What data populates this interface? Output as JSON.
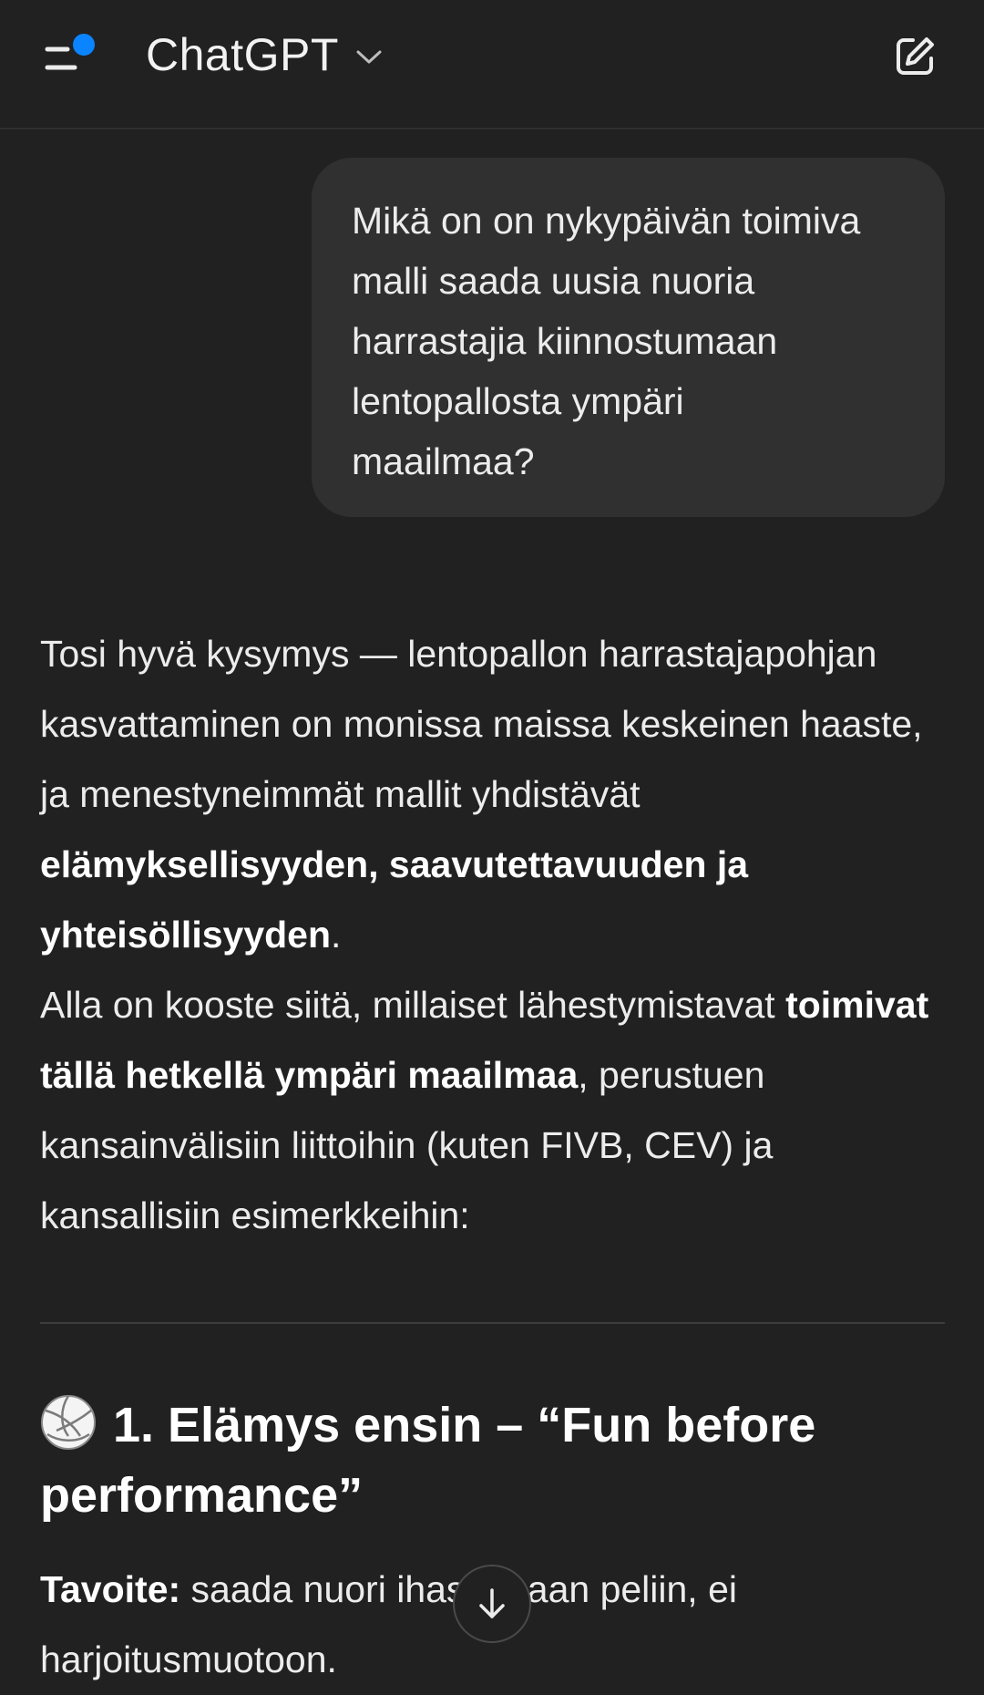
{
  "header": {
    "title": "ChatGPT",
    "menu_icon": "menu-icon",
    "notification_color": "#0A84FF",
    "chevron_icon": "chevron-down-icon",
    "compose_icon": "new-chat-icon"
  },
  "user_message": {
    "text": "Mikä on on nykypäivän toimiva\nmalli saada uusia nuoria\nharrastajia kiinnostumaan\nlentopallosta ympäri\nmaailmaa?"
  },
  "answer": {
    "p1_part1": "Tosi hyvä kysymys — lentopallon harrastajapohjan kasvattaminen on monissa maissa keskeinen haaste, ja menestyneimmät mallit yhdistävät ",
    "p1_bold": "elämyksellisyyden, saavutettavuuden ja yhteisöllisyyden",
    "p1_end": ".",
    "p2_part1": "Alla on kooste siitä, millaiset lähestymistavat ",
    "p2_bold": "toimivat tällä hetkellä ympäri maailmaa",
    "p2_part2": ", perustuen kansainvälisiin liittoihin (kuten FIVB, CEV) ja kansallisiin esimerkkeihin:"
  },
  "section": {
    "icon": "volleyball-icon",
    "title": "1. Elämys ensin – “Fun before performance”",
    "goal_label": "Tavoite:",
    "goal_text": " saada nuori ihastumaan peliin, ei harjoitusmuotoon."
  },
  "scroll_button": {
    "icon": "arrow-down-icon"
  }
}
